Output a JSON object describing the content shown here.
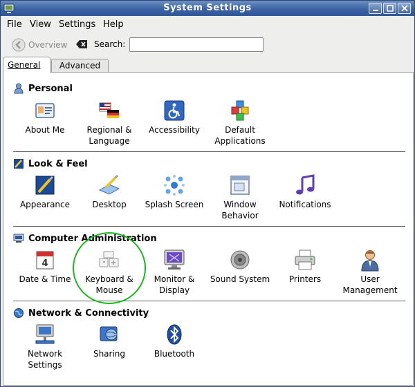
{
  "window": {
    "title": "System Settings"
  },
  "menu": [
    "File",
    "View",
    "Settings",
    "Help"
  ],
  "toolbar": {
    "overview_label": "Overview",
    "search_label": "Search:",
    "search_value": "",
    "search_placeholder": ""
  },
  "tabs": [
    "General",
    "Advanced"
  ],
  "sections": [
    {
      "title": "Personal",
      "items": [
        "About Me",
        "Regional &\nLanguage",
        "Accessibility",
        "Default\nApplications"
      ]
    },
    {
      "title": "Look & Feel",
      "items": [
        "Appearance",
        "Desktop",
        "Splash Screen",
        "Window\nBehavior",
        "Notifications"
      ]
    },
    {
      "title": "Computer Administration",
      "items": [
        "Date & Time",
        "Keyboard &\nMouse",
        "Monitor &\nDisplay",
        "Sound System",
        "Printers",
        "User\nManagement"
      ]
    },
    {
      "title": "Network & Connectivity",
      "items": [
        "Network\nSettings",
        "Sharing",
        "Bluetooth"
      ]
    }
  ],
  "colors": {
    "titlebar": "#3b63a5",
    "highlight_ring": "#1bb81b"
  }
}
